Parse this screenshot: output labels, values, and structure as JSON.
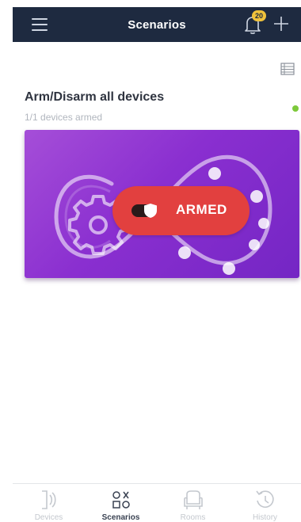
{
  "header": {
    "title": "Scenarios",
    "notification_count": "20"
  },
  "scenario": {
    "title": "Arm/Disarm all devices",
    "subtitle": "1/1 devices armed",
    "status_color": "#7dc93a",
    "state_label": "ARMED",
    "card_colors": [
      "#a54ed8",
      "#7426c4"
    ],
    "pill_color": "#e2403f"
  },
  "nav": {
    "items": [
      {
        "label": "Devices",
        "icon": "devices-icon",
        "active": false
      },
      {
        "label": "Scenarios",
        "icon": "scenarios-icon",
        "active": true
      },
      {
        "label": "Rooms",
        "icon": "rooms-icon",
        "active": false
      },
      {
        "label": "History",
        "icon": "history-icon",
        "active": false
      }
    ]
  }
}
